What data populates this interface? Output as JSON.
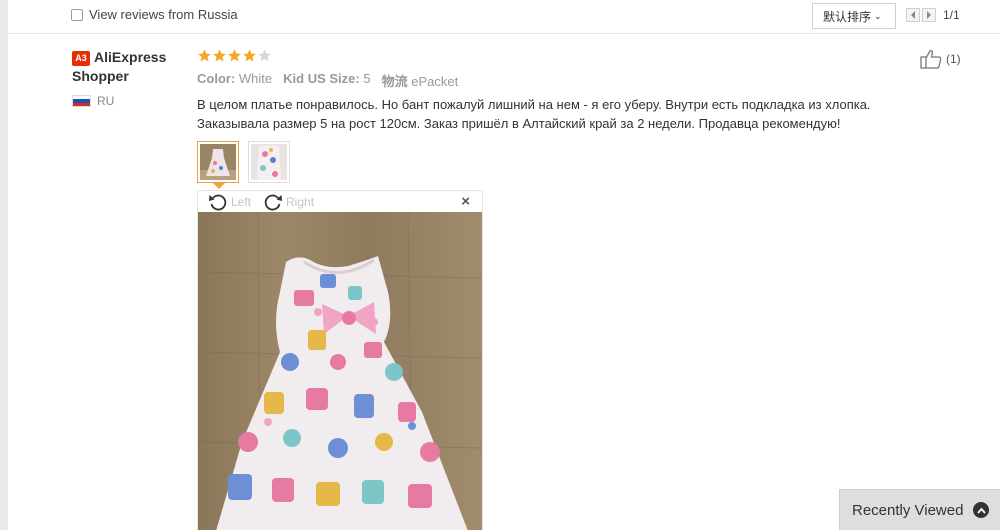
{
  "filter": {
    "label": "View reviews from Russia",
    "checked": false
  },
  "sort": {
    "label": "默认排序"
  },
  "pager": {
    "count": "1/1"
  },
  "reviewer": {
    "badge": "A3",
    "name": "AliExpress Shopper",
    "country_code": "RU",
    "flag_colors": [
      "#ffffff",
      "#2450b4",
      "#d52b1e"
    ]
  },
  "review": {
    "rating": 4,
    "rating_max": 5,
    "star_color": "#f5a623",
    "attributes": [
      {
        "key": "Color:",
        "value": "White"
      },
      {
        "key": "Kid US Size:",
        "value": "5"
      },
      {
        "key": "物流",
        "value": "ePacket"
      }
    ],
    "text_line1": "В целом платье понравилось. Но бант пожалуй лишний на нем - я его уберу. Внутри есть подкладка из хлопка.",
    "text_line2": "Заказывала размер 5 на рост 120см. Заказ пришёл в Алтайский край за 2 недели. Продавца рекомендую!",
    "helpful_count": "(1)"
  },
  "viewer": {
    "rotate_left_label": "Left",
    "rotate_right_label": "Right",
    "close_label": "×"
  },
  "recently_viewed": {
    "label": "Recently Viewed"
  }
}
